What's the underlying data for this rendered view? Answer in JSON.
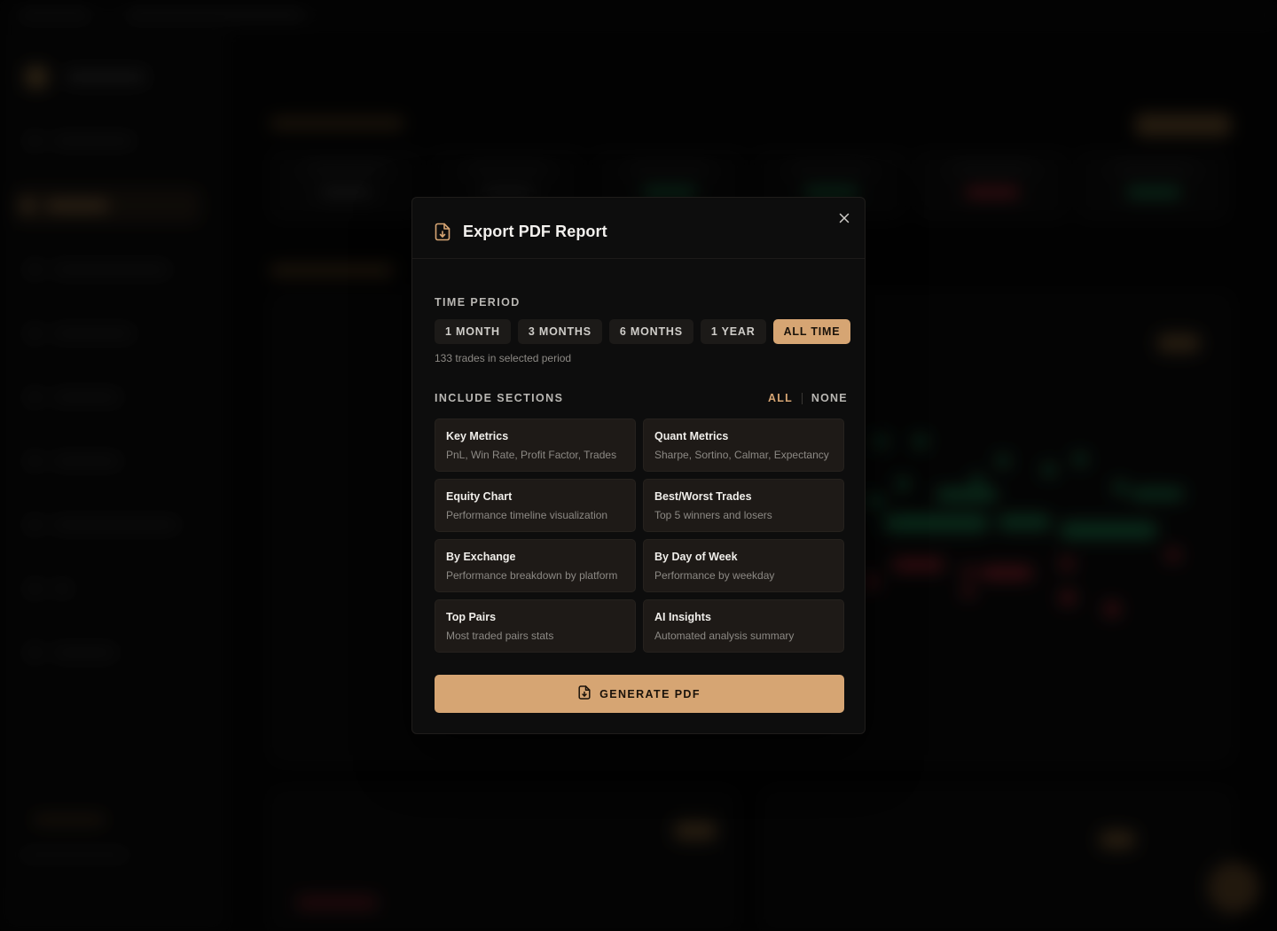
{
  "modal": {
    "title": "Export PDF Report",
    "time_period_label": "TIME PERIOD",
    "periods": [
      {
        "label": "1 MONTH",
        "active": false
      },
      {
        "label": "3 MONTHS",
        "active": false
      },
      {
        "label": "6 MONTHS",
        "active": false
      },
      {
        "label": "1 YEAR",
        "active": false
      },
      {
        "label": "ALL TIME",
        "active": true
      }
    ],
    "trades_note": "133 trades in selected period",
    "include_sections_label": "INCLUDE SECTIONS",
    "select_all": "ALL",
    "select_none": "NONE",
    "sections": [
      {
        "title": "Key Metrics",
        "desc": "PnL, Win Rate, Profit Factor, Trades"
      },
      {
        "title": "Quant Metrics",
        "desc": "Sharpe, Sortino, Calmar, Expectancy"
      },
      {
        "title": "Equity Chart",
        "desc": "Performance timeline visualization"
      },
      {
        "title": "Best/Worst Trades",
        "desc": "Top 5 winners and losers"
      },
      {
        "title": "By Exchange",
        "desc": "Performance breakdown by platform"
      },
      {
        "title": "By Day of Week",
        "desc": "Performance by weekday"
      },
      {
        "title": "Top Pairs",
        "desc": "Most traded pairs stats"
      },
      {
        "title": "AI Insights",
        "desc": "Automated analysis summary"
      }
    ],
    "generate_label": "GENERATE PDF"
  },
  "icons": {
    "header": "file-download-icon",
    "close": "close-icon",
    "generate": "file-download-icon"
  },
  "colors": {
    "accent": "#d6a573",
    "modal_bg": "#0d0d0d",
    "card_bg": "#1e1a17",
    "profit": "#1f8a55",
    "loss": "#b02a36"
  }
}
